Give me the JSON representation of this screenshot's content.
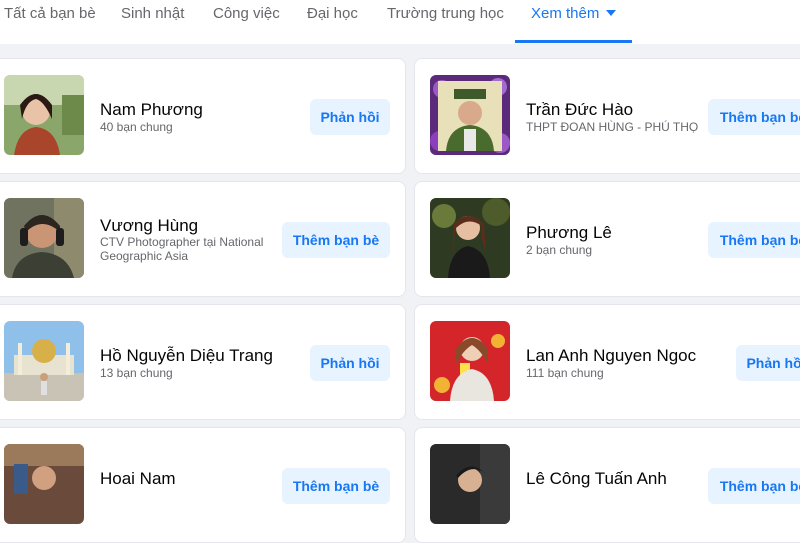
{
  "tabs": {
    "all_friends": "Tất cả bạn bè",
    "birthdays": "Sinh nhật",
    "work": "Công việc",
    "university": "Đại học",
    "high_school": "Trường trung học",
    "see_more": "Xem thêm"
  },
  "accent_color": "#1877f2",
  "people": [
    {
      "name": "Nam Phương",
      "sub": "40 bạn chung",
      "button": "Phản hồi"
    },
    {
      "name": "Trần Đức Hào",
      "sub": "THPT ĐOAN HÙNG - PHÚ THỌ",
      "button": "Thêm bạn bè"
    },
    {
      "name": "Vương Hùng",
      "sub": "CTV Photographer tại National Geographic Asia",
      "button": "Thêm bạn bè"
    },
    {
      "name": "Phương Lê",
      "sub": "2 bạn chung",
      "button": "Thêm bạn bè"
    },
    {
      "name": "Hồ Nguyễn Diệu Trang",
      "sub": "13 bạn chung",
      "button": "Phản hồi"
    },
    {
      "name": "Lan Anh Nguyen Ngoc",
      "sub": "111 bạn chung",
      "button": "Phản hồi"
    },
    {
      "name": "Hoai Nam",
      "sub": "",
      "button": "Thêm bạn bè"
    },
    {
      "name": "Lê Công Tuấn Anh",
      "sub": "",
      "button": "Thêm bạn bè"
    }
  ]
}
